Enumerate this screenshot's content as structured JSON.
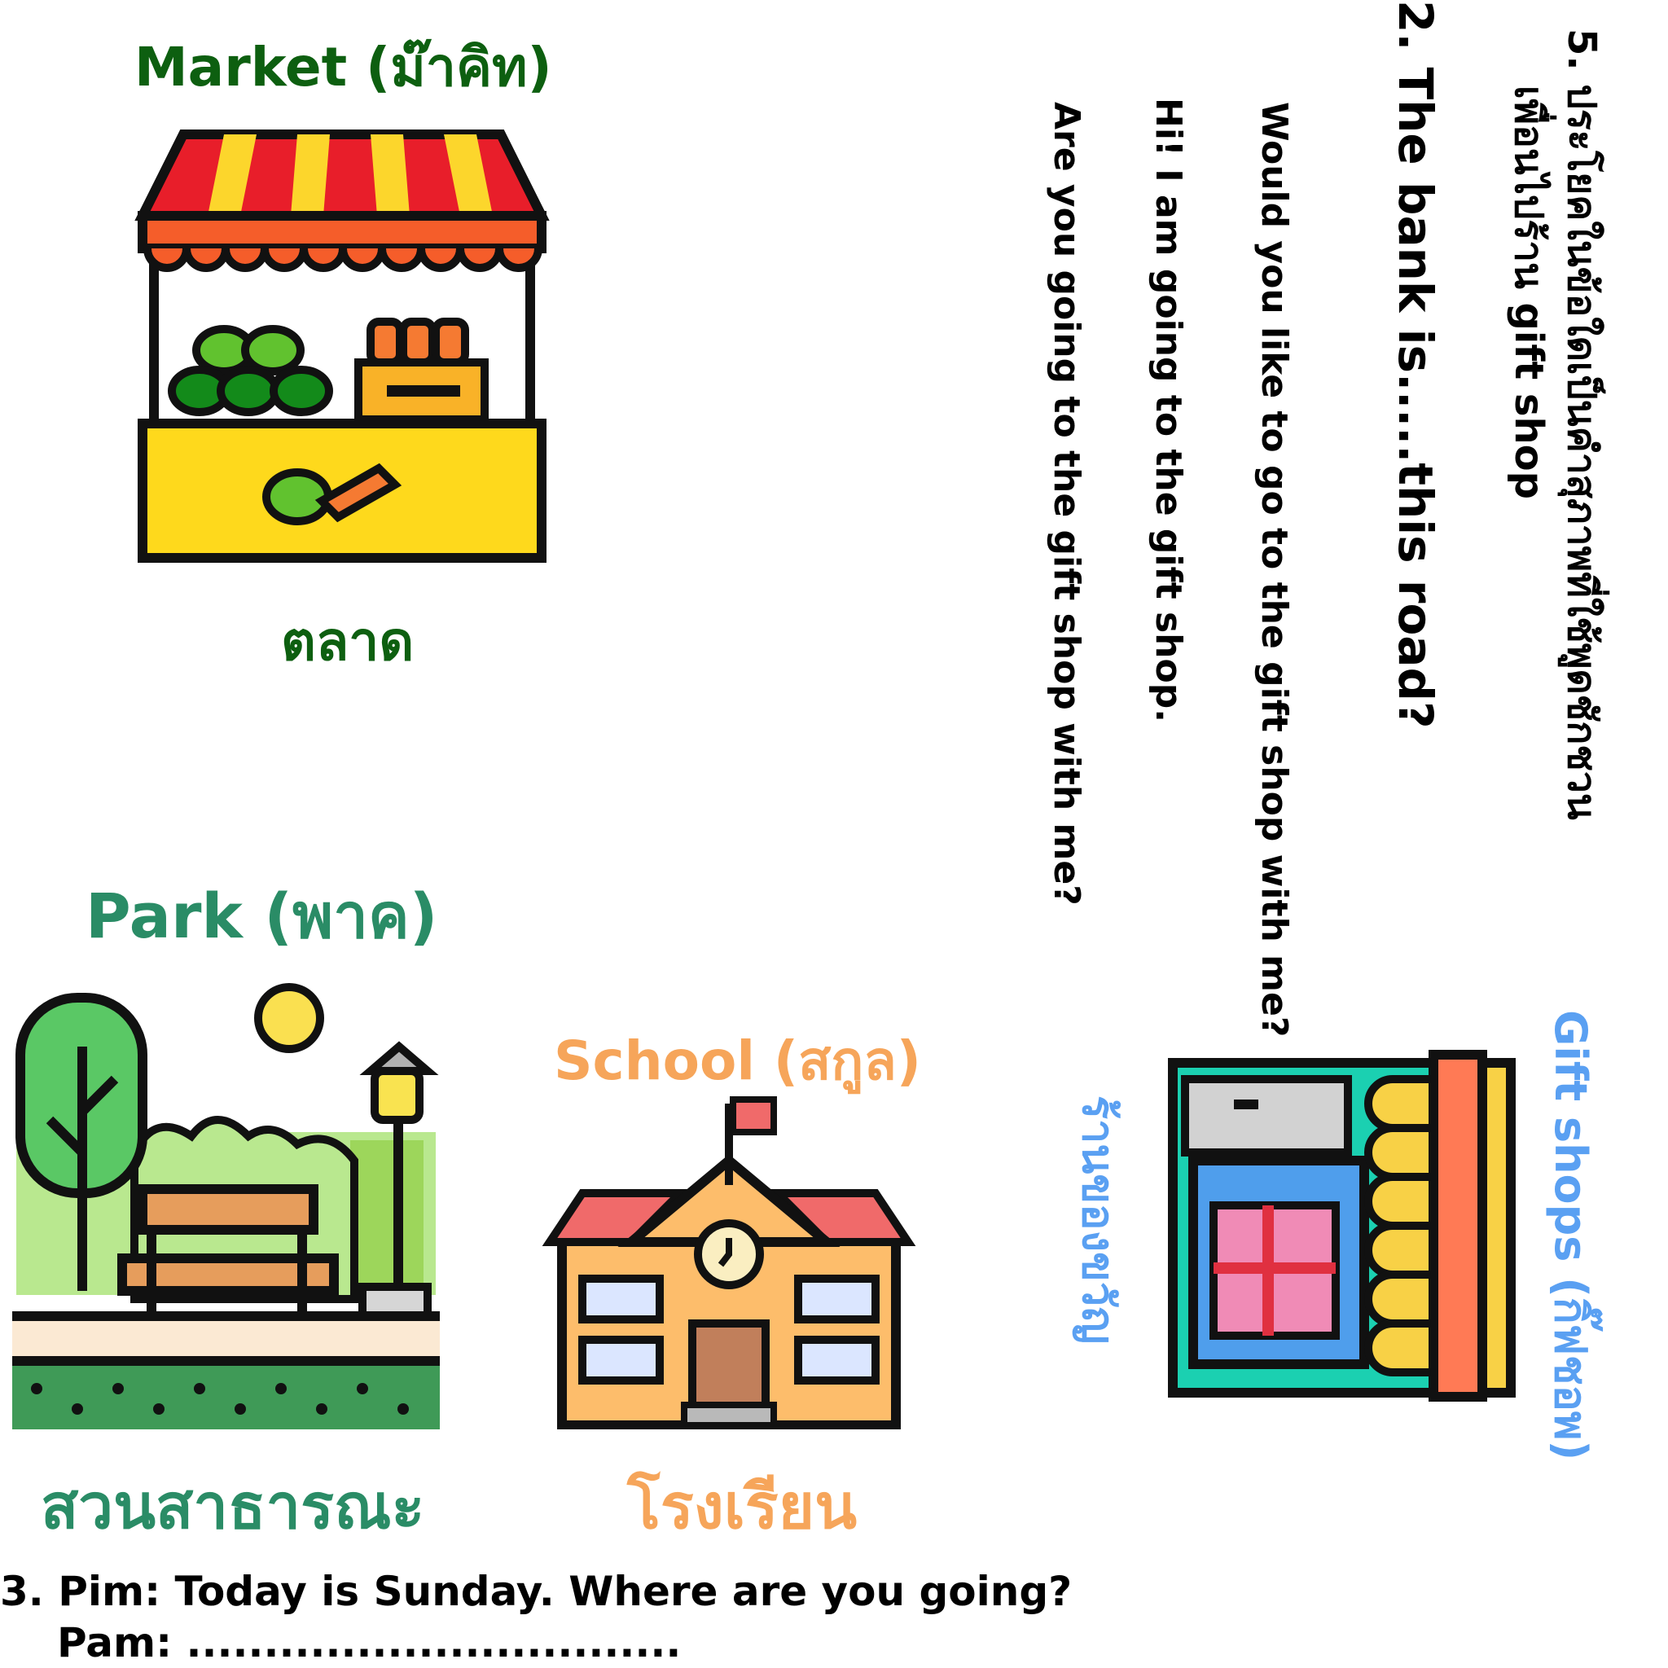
{
  "colors": {
    "green_dark": "#0d5f10",
    "green_park": "#2a8c66",
    "orange": "#f6a55a",
    "blue": "#5aa0f2"
  },
  "market": {
    "title": "Market (ม๊าคิท)",
    "thai": "ตลาด",
    "icon": "market-stall-icon"
  },
  "park": {
    "title": "Park (พาค)",
    "thai": "สวนสาธารณะ",
    "icon": "park-icon"
  },
  "school": {
    "title": "School (สกูล)",
    "thai": "โรงเรียน",
    "icon": "school-icon"
  },
  "gift_shop": {
    "title": "Gift shops (กิ๊ฟชอพ)",
    "thai": "ร้านของขวัญ",
    "icon": "gift-shop-icon"
  },
  "question5": {
    "line1": "5. ประโยคในข้อใดเป็นคำสุภาพที่ใช้พูดชักชวน",
    "line2": "เพื่อนไปร้าน gift shop",
    "options": [
      "Would you like to go to the gift shop with me?",
      "Hi! I am going to the gift shop.",
      "Are you going to the gift shop with me?"
    ]
  },
  "question2": {
    "text": "2. The bank is.....this road?"
  },
  "question3": {
    "line1": "3. Pim: Today is Sunday. Where are you going?",
    "line2": "Pam: ................................"
  }
}
